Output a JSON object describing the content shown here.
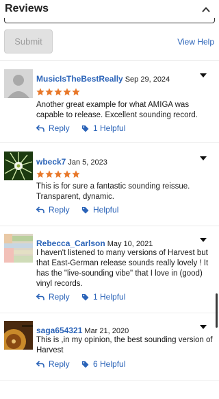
{
  "header": {
    "title": "Reviews"
  },
  "form": {
    "submit_label": "Submit",
    "view_help_label": "View Help"
  },
  "reviews": [
    {
      "username": "MusicIsTheBestReally",
      "date": "Sep 29, 2024",
      "text": "Another great example for what AMIGA was capable to release. Excellent sounding record.",
      "rating": 5,
      "reply_label": "Reply",
      "helpful_label": "1 Helpful"
    },
    {
      "username": "wbeck7",
      "date": "Jan 5, 2023",
      "text": "This is for sure a fantastic sounding reissue. Transparent, dynamic.",
      "rating": 5,
      "reply_label": "Reply",
      "helpful_label": "Helpful"
    },
    {
      "username": "Rebecca_Carlson",
      "date": "May 10, 2021",
      "text": "I haven't listened to many versions of Harvest but that East-German release sounds really lovely ! It has the \"live-sounding vibe\" that I love in (good) vinyl records.",
      "rating": 0,
      "reply_label": "Reply",
      "helpful_label": "1 Helpful"
    },
    {
      "username": "saga654321",
      "date": "Mar 21, 2020",
      "text": "This is ,in my opinion, the best sounding version of Harvest",
      "rating": 0,
      "reply_label": "Reply",
      "helpful_label": "6 Helpful"
    }
  ],
  "colors": {
    "link": "#2a63b8",
    "star": "#e8782a",
    "divider": "#ececec"
  },
  "icons": [
    "chevron-up-icon",
    "reply-arrow-icon",
    "tag-icon",
    "star-icon",
    "caret-down-icon"
  ]
}
